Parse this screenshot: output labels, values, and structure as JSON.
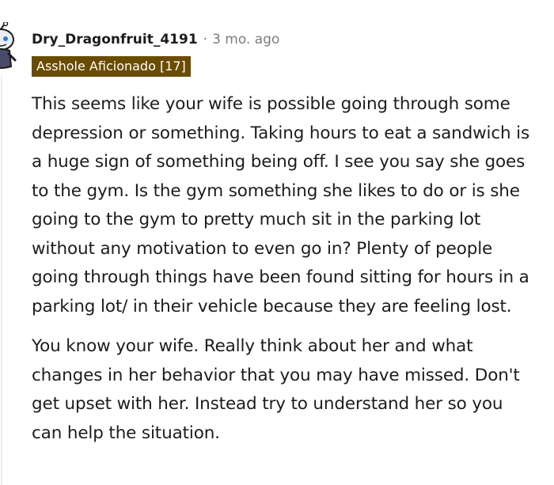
{
  "comment": {
    "author": "Dry_Dragonfruit_4191",
    "separator": "·",
    "age": "3 mo. ago",
    "flair": "Asshole Aficionado [17]",
    "avatar_icon": "snoo-avatar-icon",
    "flair_color": "#6a4c00",
    "paragraphs": [
      "This seems like your wife is possible going through some depression or something. Taking hours to eat a sandwich is a huge sign of something being off. I see you say she goes to the gym. Is the gym something she likes to do or is she going to the gym to pretty much sit in the parking lot without any motivation to even go in? Plenty of people going through things have been found sitting for hours in a parking lot/ in their vehicle because they are feeling lost.",
      "You know your wife. Really think about her and what changes in her behavior that you may have missed. Don't get upset with her. Instead try to understand her so you can help the situation."
    ]
  }
}
